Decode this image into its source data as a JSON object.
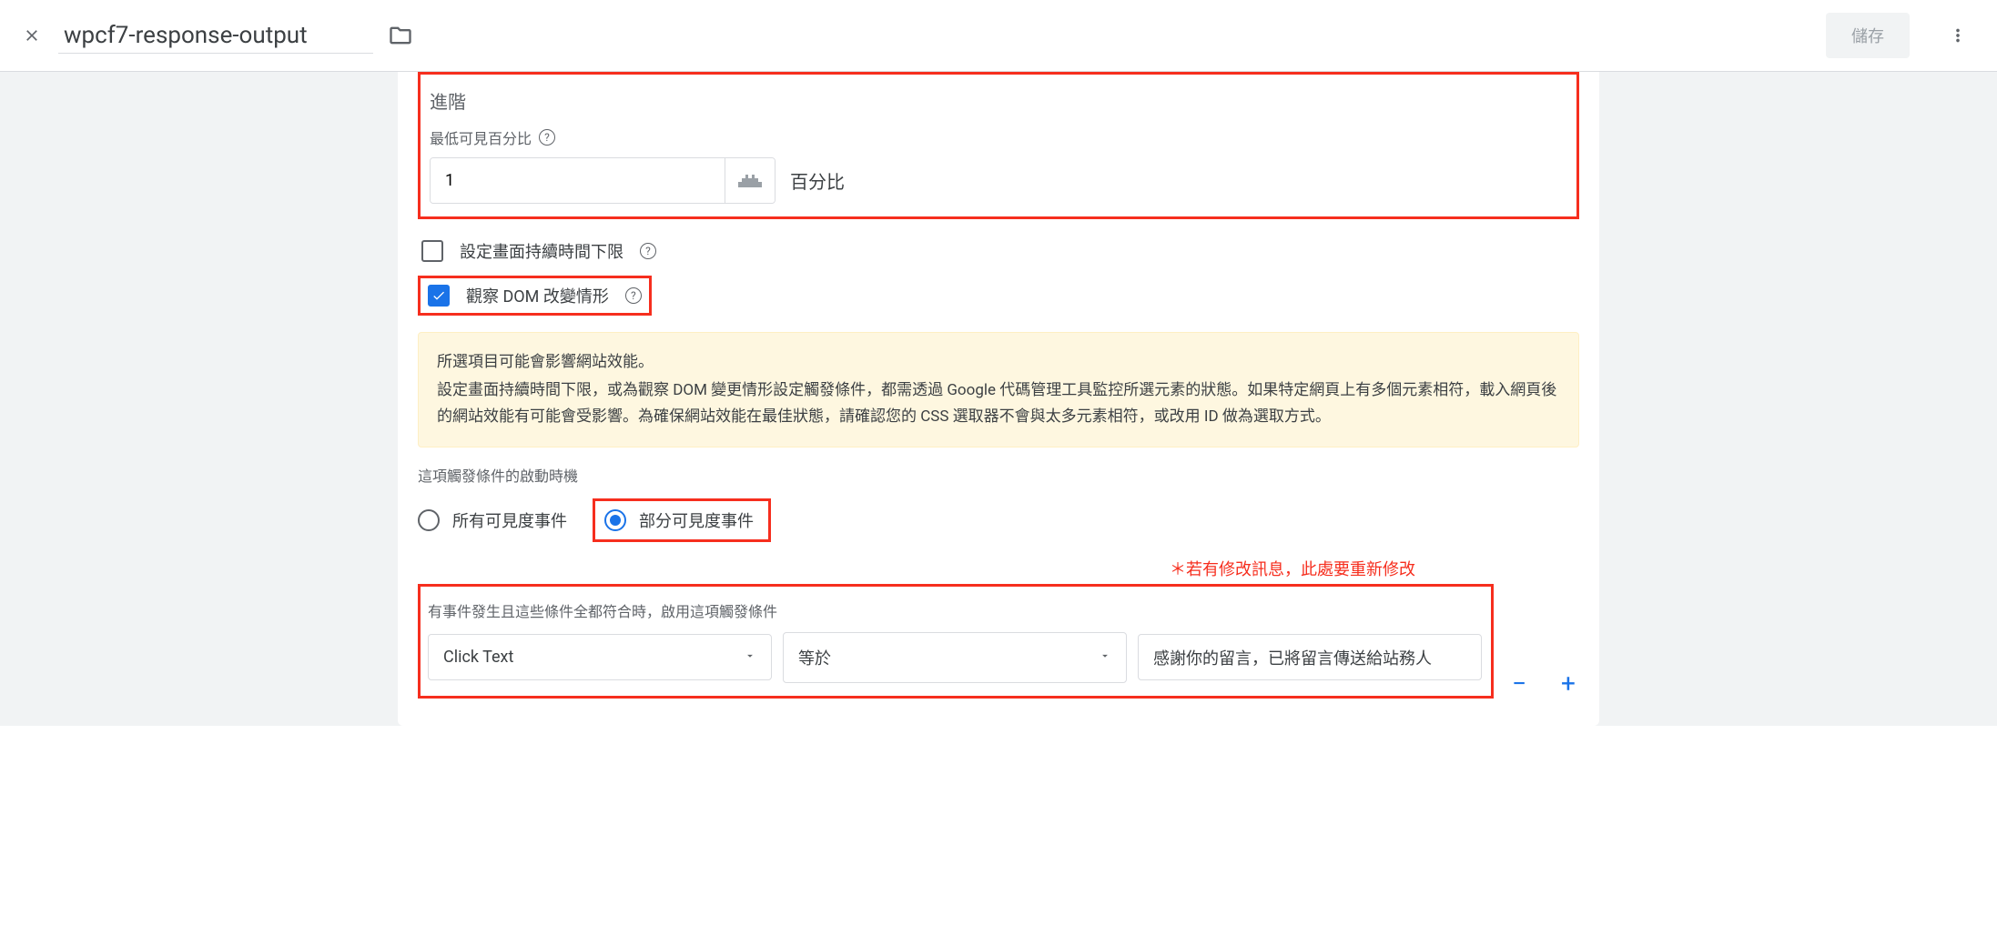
{
  "header": {
    "title": "wpcf7-response-output",
    "save_label": "儲存"
  },
  "advanced": {
    "heading": "進階",
    "min_percent_label": "最低可見百分比",
    "min_percent_value": "1",
    "percent_suffix": "百分比"
  },
  "duration_checkbox": {
    "label": "設定畫面持續時間下限",
    "checked": false
  },
  "dom_checkbox": {
    "label": "觀察 DOM 改變情形",
    "checked": true
  },
  "warning": {
    "title": "所選項目可能會影響網站效能。",
    "body": "設定畫面持續時間下限，或為觀察 DOM 變更情形設定觸發條件，都需透過 Google 代碼管理工具監控所選元素的狀態。如果特定網頁上有多個元素相符，載入網頁後的網站效能有可能會受影響。為確保網站效能在最佳狀態，請確認您的 CSS 選取器不會與太多元素相符，或改用 ID 做為選取方式。"
  },
  "timing": {
    "label": "這項觸發條件的啟動時機",
    "option_all": "所有可見度事件",
    "option_partial": "部分可見度事件"
  },
  "annotation": "＊若有修改訊息，此處要重新修改",
  "conditions": {
    "label": "有事件發生且這些條件全都符合時，啟用這項觸發條件",
    "variable": "Click Text",
    "operator": "等於",
    "value": "感謝你的留言，已將留言傳送給站務人"
  }
}
